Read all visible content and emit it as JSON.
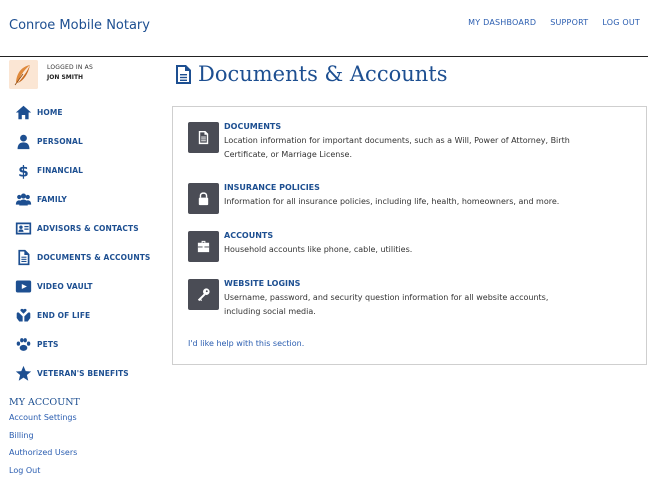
{
  "header": {
    "brand": "Conroe Mobile Notary",
    "nav": [
      "MY DASHBOARD",
      "SUPPORT",
      "LOG OUT"
    ]
  },
  "user": {
    "logged_in_label": "LOGGED IN AS",
    "name": "JON SMITH"
  },
  "sidebar": {
    "items": [
      {
        "label": "HOME",
        "icon": "home-icon"
      },
      {
        "label": "PERSONAL",
        "icon": "person-icon"
      },
      {
        "label": "FINANCIAL",
        "icon": "dollar-icon"
      },
      {
        "label": "FAMILY",
        "icon": "family-icon"
      },
      {
        "label": "ADVISORS & CONTACTS",
        "icon": "contact-card-icon"
      },
      {
        "label": "DOCUMENTS & ACCOUNTS",
        "icon": "document-icon"
      },
      {
        "label": "VIDEO VAULT",
        "icon": "video-icon"
      },
      {
        "label": "END OF LIFE",
        "icon": "hands-icon"
      },
      {
        "label": "PETS",
        "icon": "paw-icon"
      },
      {
        "label": "VETERAN'S BENEFITS",
        "icon": "star-icon"
      }
    ]
  },
  "my_account": {
    "title": "MY ACCOUNT",
    "links": [
      "Account Settings",
      "Billing",
      "Authorized Users",
      "Log Out"
    ]
  },
  "main": {
    "title": "Documents & Accounts",
    "sections": [
      {
        "title": "DOCUMENTS",
        "description_lines": [
          "Location information for important documents, such as a Will, Power of Attorney, Birth",
          "Certificate, or Marriage License."
        ],
        "icon": "file-icon"
      },
      {
        "title": "INSURANCE POLICIES",
        "description_lines": [
          "Information for all insurance policies, including life, health, homeowners, and more."
        ],
        "icon": "lock-icon"
      },
      {
        "title": "ACCOUNTS",
        "description_lines": [
          "Household accounts like phone, cable, utilities."
        ],
        "icon": "briefcase-icon"
      },
      {
        "title": "WEBSITE LOGINS",
        "description_lines": [
          "Username, password, and security question information for all website accounts,",
          "including social media."
        ],
        "icon": "key-icon"
      }
    ],
    "help_link": "I'd like help with this section."
  },
  "colors": {
    "brand_blue": "#1d4f91",
    "link_blue": "#2a5db0",
    "icon_tile": "#4a4c55"
  }
}
